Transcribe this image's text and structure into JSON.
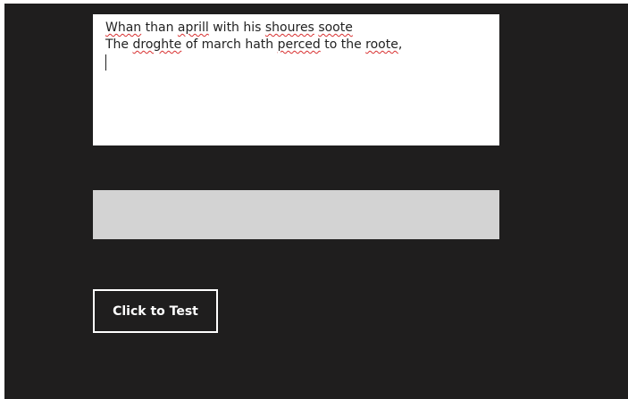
{
  "editor": {
    "lines": [
      [
        {
          "text": "Whan",
          "misspelled": true
        },
        {
          "text": " than ",
          "misspelled": false
        },
        {
          "text": "aprill",
          "misspelled": true
        },
        {
          "text": " with his ",
          "misspelled": false
        },
        {
          "text": "shoures",
          "misspelled": true
        },
        {
          "text": " ",
          "misspelled": false
        },
        {
          "text": "soote",
          "misspelled": true
        }
      ],
      [
        {
          "text": "The ",
          "misspelled": false
        },
        {
          "text": "droghte",
          "misspelled": true
        },
        {
          "text": " of march hath ",
          "misspelled": false
        },
        {
          "text": "perced",
          "misspelled": true
        },
        {
          "text": " to the ",
          "misspelled": false
        },
        {
          "text": "roote",
          "misspelled": true
        },
        {
          "text": ",",
          "misspelled": false
        }
      ]
    ]
  },
  "output": {
    "value": ""
  },
  "button": {
    "label": "Click to Test"
  }
}
